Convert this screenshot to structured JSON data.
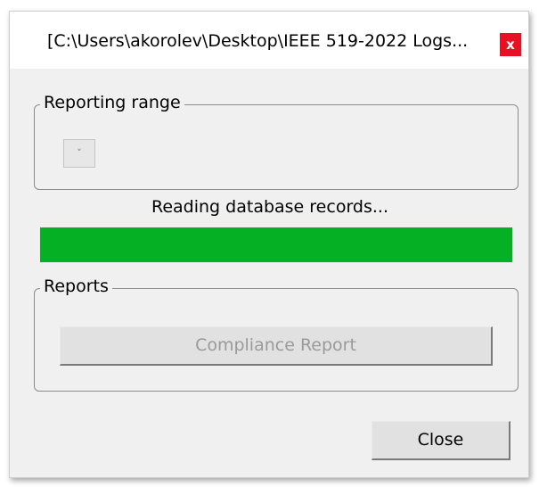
{
  "window": {
    "title": "[C:\\Users\\akorolev\\Desktop\\IEEE 519-2022 Logs...",
    "close_glyph": "x"
  },
  "reporting_range": {
    "legend": "Reporting range",
    "dropdown_glyph": "˅"
  },
  "status": {
    "text": "Reading database records...",
    "progress_percent": 100
  },
  "reports": {
    "legend": "Reports",
    "compliance_button": "Compliance Report"
  },
  "footer": {
    "close_button": "Close"
  },
  "colors": {
    "progress": "#06b025",
    "close_bg": "#e81123"
  }
}
